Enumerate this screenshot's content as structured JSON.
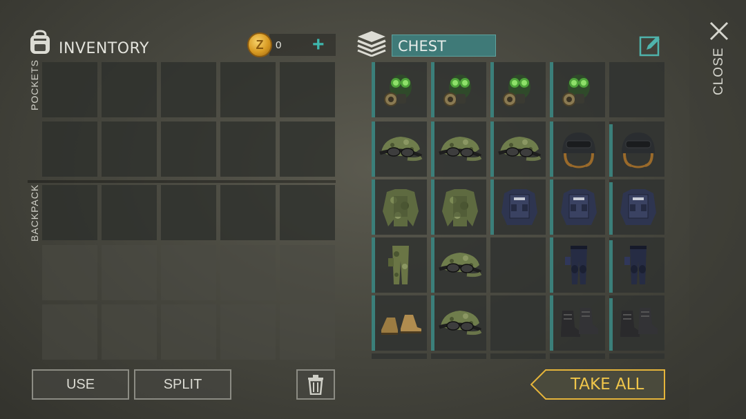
{
  "inventory": {
    "title": "INVENTORY",
    "coins": "0",
    "add_coins_icon": "plus-icon",
    "pockets_label": "POCKETS",
    "backpack_label": "BACKPACK"
  },
  "chest": {
    "name": "CHEST",
    "rows": [
      [
        "gas-mask",
        "gas-mask",
        "gas-mask",
        "gas-mask",
        "empty"
      ],
      [
        "camo-cap-goggles",
        "camo-cap-goggles",
        "camo-cap-goggles",
        "tactical-helmet",
        "tactical-helmet"
      ],
      [
        "camo-jacket",
        "camo-jacket",
        "police-vest",
        "police-vest",
        "police-vest"
      ],
      [
        "camo-pants",
        "camo-cap-goggles",
        "empty",
        "police-pants",
        "police-pants"
      ],
      [
        "tan-boots",
        "camo-cap-goggles",
        "empty",
        "black-boots",
        "black-boots"
      ]
    ]
  },
  "actions": {
    "use": "USE",
    "split": "SPLIT",
    "take_all": "TAKE ALL",
    "close": "CLOSE"
  },
  "colors": {
    "accent_teal": "#3b7f7a",
    "take_all_gold": "#e6b53a",
    "coin_gold": "#d89a22"
  }
}
